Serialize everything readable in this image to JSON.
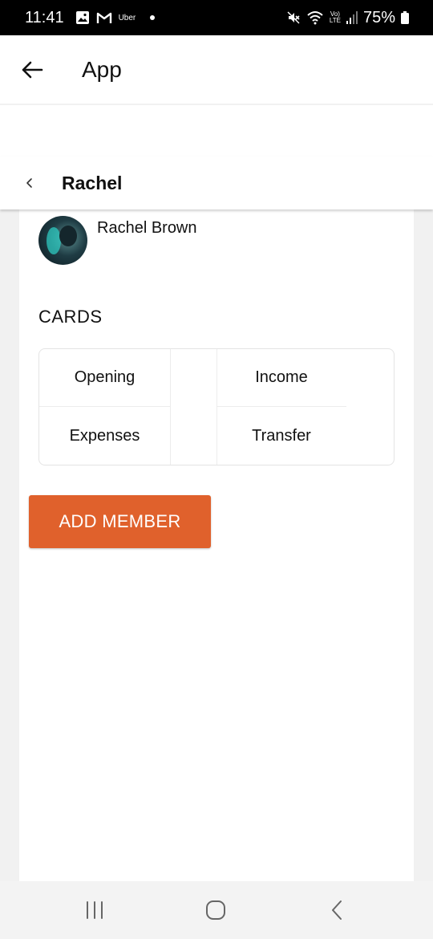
{
  "status_bar": {
    "time": "11:41",
    "notification_app": "Uber",
    "volte_top": "Vo)",
    "volte_bottom": "LTE",
    "battery": "75%",
    "icons": [
      "gallery-icon",
      "gmail-icon",
      "mute-icon",
      "wifi-icon",
      "signal-icon",
      "battery-icon"
    ]
  },
  "app_bar": {
    "title": "App",
    "back_icon": "arrow-left-icon"
  },
  "sub_header": {
    "title": "Rachel",
    "back_icon": "chevron-left-icon"
  },
  "profile": {
    "name": "Rachel Brown"
  },
  "cards": {
    "label": "CARDS",
    "items": [
      {
        "label": "Opening"
      },
      {
        "label": "Income"
      },
      {
        "label": "Expenses"
      },
      {
        "label": "Transfer"
      }
    ]
  },
  "actions": {
    "add_member_label": "ADD MEMBER"
  },
  "colors": {
    "accent": "#e0612c",
    "status_bar": "#000000",
    "background": "#f1f1f1"
  },
  "nav": {
    "icons": [
      "recent-apps-icon",
      "home-icon",
      "back-icon"
    ]
  }
}
